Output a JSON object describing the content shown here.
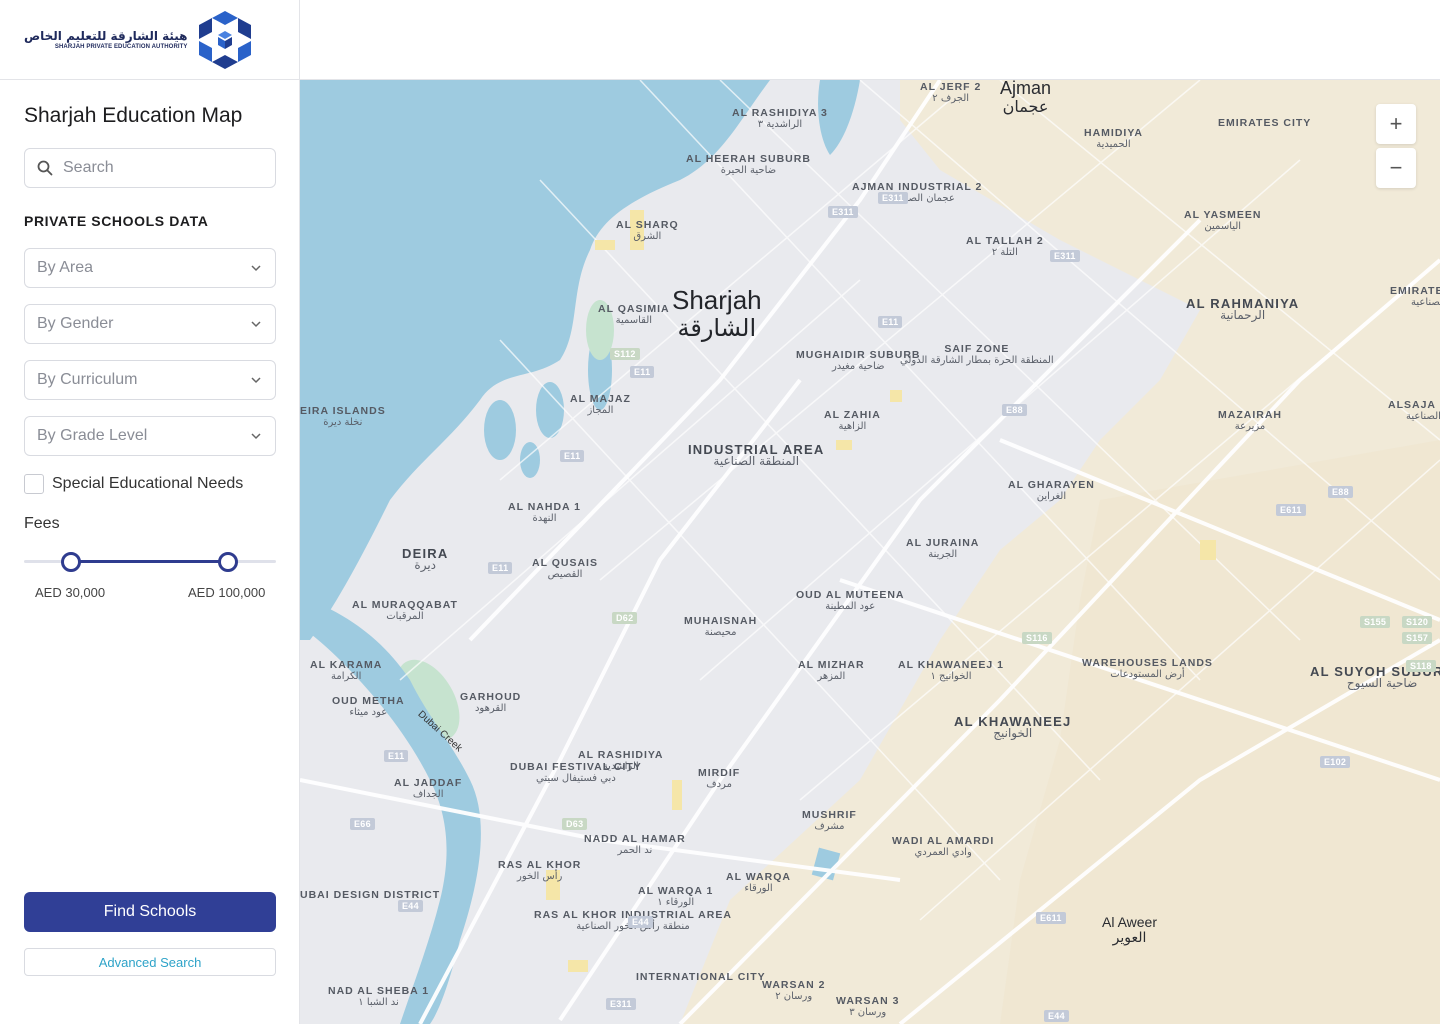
{
  "logo": {
    "arabic": "هيئة الشارقة للتعليم الخاص",
    "english": "SHARJAH PRIVATE EDUCATION AUTHORITY"
  },
  "sidebar": {
    "title": "Sharjah Education Map",
    "search_placeholder": "Search",
    "section_label": "PRIVATE SCHOOLS DATA",
    "filters": [
      {
        "label": "By Area"
      },
      {
        "label": "By Gender"
      },
      {
        "label": "By Curriculum"
      },
      {
        "label": "By Grade Level"
      }
    ],
    "special_needs_label": "Special Educational Needs",
    "fees_label": "Fees",
    "fees_min": "AED 30,000",
    "fees_max": "AED 100,000",
    "find_button": "Find Schools",
    "advanced_button": "Advanced Search"
  },
  "map": {
    "zoom_in": "+",
    "zoom_out": "−",
    "creek_label": "Dubai Creek",
    "places": [
      {
        "en": "Ajman",
        "ar": "عجمان",
        "cls": "mid"
      },
      {
        "en": "AL JERF 2",
        "ar": "الجرف ٢",
        "cls": ""
      },
      {
        "en": "AL RASHIDIYA 3",
        "ar": "الراشدية ٣",
        "cls": ""
      },
      {
        "en": "HAMIDIYA",
        "ar": "الحميدية",
        "cls": ""
      },
      {
        "en": "EMIRATES CITY",
        "ar": "",
        "cls": ""
      },
      {
        "en": "AL HEERAH SUBURB",
        "ar": "ضاحية الحيرة",
        "cls": ""
      },
      {
        "en": "AJMAN INDUSTRIAL 2",
        "ar": "عجمان الصناعية ٢",
        "cls": ""
      },
      {
        "en": "AL YASMEEN",
        "ar": "الياسمين",
        "cls": ""
      },
      {
        "en": "AL SHARQ",
        "ar": "الشرق",
        "cls": ""
      },
      {
        "en": "AL TALLAH 2",
        "ar": "التلة ٢",
        "cls": ""
      },
      {
        "en": "Sharjah",
        "ar": "الشارقة",
        "cls": "city"
      },
      {
        "en": "AL QASIMIA",
        "ar": "القاسمية",
        "cls": ""
      },
      {
        "en": "AL RAHMANIYA",
        "ar": "الرحمانية",
        "cls": "big"
      },
      {
        "en": "EMIRATES INDUSTRIAL",
        "ar": "مدينة الإمارات الصناعية",
        "cls": ""
      },
      {
        "en": "MUGHAIDIR SUBURB",
        "ar": "ضاحية مغيدر",
        "cls": ""
      },
      {
        "en": "SAIF ZONE",
        "ar": "المنطقة الحرة بمطار الشارقة الدولي",
        "cls": ""
      },
      {
        "en": "AL MAJAZ",
        "ar": "المجاز",
        "cls": ""
      },
      {
        "en": "EIRA ISLANDS",
        "ar": "نخلة ديرة",
        "cls": ""
      },
      {
        "en": "AL ZAHIA",
        "ar": "الزاهية",
        "cls": ""
      },
      {
        "en": "MAZAIRAH",
        "ar": "مزيرعة",
        "cls": ""
      },
      {
        "en": "ALSAJA INDUSTR",
        "ar": "الصجعة الصناعية",
        "cls": ""
      },
      {
        "en": "INDUSTRIAL AREA",
        "ar": "المنطقة الصناعية",
        "cls": "big"
      },
      {
        "en": "AL GHARAYEN",
        "ar": "الغراين",
        "cls": ""
      },
      {
        "en": "AL NAHDA 1",
        "ar": "النهدة",
        "cls": ""
      },
      {
        "en": "AL JURAINA",
        "ar": "الجرينة",
        "cls": ""
      },
      {
        "en": "DEIRA",
        "ar": "ديرة",
        "cls": "big"
      },
      {
        "en": "AL QUSAIS",
        "ar": "القصيص",
        "cls": ""
      },
      {
        "en": "AL MURAQQABAT",
        "ar": "المرقبات",
        "cls": ""
      },
      {
        "en": "OUD AL MUTEENA",
        "ar": "عود المطينة",
        "cls": ""
      },
      {
        "en": "MUHAISNAH",
        "ar": "محيصنة",
        "cls": ""
      },
      {
        "en": "AL KARAMA",
        "ar": "الكرامة",
        "cls": ""
      },
      {
        "en": "AL MIZHAR",
        "ar": "المزهر",
        "cls": ""
      },
      {
        "en": "AL KHAWANEEJ 1",
        "ar": "الخوانيج ١",
        "cls": ""
      },
      {
        "en": "WAREHOUSES LANDS",
        "ar": "أرض المستودعات",
        "cls": ""
      },
      {
        "en": "AL SUYOH SUBURB",
        "ar": "ضاحية السيوح",
        "cls": "big"
      },
      {
        "en": "OUD METHA",
        "ar": "عود ميثاء",
        "cls": ""
      },
      {
        "en": "GARHOUD",
        "ar": "القرهود",
        "cls": ""
      },
      {
        "en": "AL KHAWANEEJ",
        "ar": "الخوانيج",
        "cls": "big"
      },
      {
        "en": "AL RASHIDIYA",
        "ar": "الراشدية",
        "cls": ""
      },
      {
        "en": "DUBAI FESTIVAL CITY",
        "ar": "دبي فستيفال سيتي",
        "cls": ""
      },
      {
        "en": "MIRDIF",
        "ar": "مردف",
        "cls": ""
      },
      {
        "en": "AL JADDAF",
        "ar": "الجداف",
        "cls": ""
      },
      {
        "en": "MUSHRIF",
        "ar": "مشرف",
        "cls": ""
      },
      {
        "en": "NADD AL HAMAR",
        "ar": "ند الحمر",
        "cls": ""
      },
      {
        "en": "WADI AL AMARDI",
        "ar": "وادي العمردي",
        "cls": ""
      },
      {
        "en": "RAS AL KHOR",
        "ar": "رأس الخور",
        "cls": ""
      },
      {
        "en": "AL WARQA",
        "ar": "الورقاء",
        "cls": ""
      },
      {
        "en": "AL WARQA 1",
        "ar": "الورقاء ١",
        "cls": ""
      },
      {
        "en": "UBAI DESIGN DISTRICT",
        "ar": "",
        "cls": ""
      },
      {
        "en": "RAS AL KHOR INDUSTRIAL AREA",
        "ar": "منطقة رأس الخور الصناعية",
        "cls": ""
      },
      {
        "en": "Al Aweer",
        "ar": "العوير",
        "cls": "town"
      },
      {
        "en": "INTERNATIONAL CITY",
        "ar": "",
        "cls": ""
      },
      {
        "en": "WARSAN 2",
        "ar": "ورسان ٢",
        "cls": ""
      },
      {
        "en": "WARSAN 3",
        "ar": "ورسان ٣",
        "cls": ""
      },
      {
        "en": "NAD AL SHEBA 1",
        "ar": "ند الشبا ١",
        "cls": ""
      }
    ],
    "roads": [
      "E311",
      "E11",
      "E311",
      "E311",
      "E88",
      "S112",
      "E11",
      "E11",
      "E11",
      "E88",
      "E611",
      "D62",
      "S116",
      "S155",
      "S120",
      "S157",
      "S118",
      "E11",
      "E66",
      "D63",
      "E102",
      "E44",
      "E44",
      "E611",
      "E311",
      "E44"
    ]
  }
}
